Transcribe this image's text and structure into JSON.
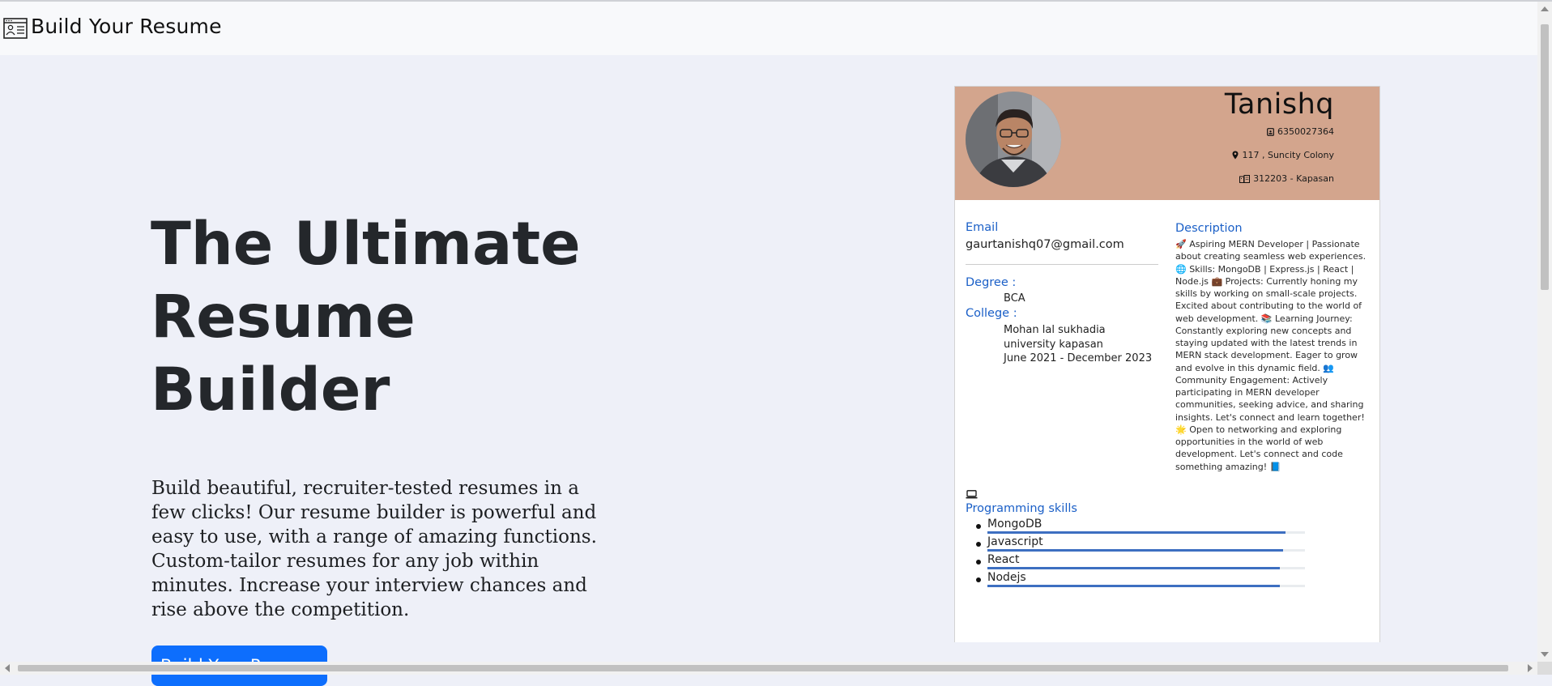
{
  "navbar": {
    "brand": "Build Your Resume",
    "brand_icon": "resume-card-icon"
  },
  "hero": {
    "title_lines": [
      "The Ultimate",
      "Resume",
      "Builder"
    ],
    "text": "Build beautiful, recruiter-tested resumes in a few clicks! Our resume builder is powerful and easy to use, with a range of amazing functions. Custom-tailor resumes for any job within minutes. Increase your interview chances and rise above the competition.",
    "button": "Build Your Resume"
  },
  "resume": {
    "header_color": "#d3a58d",
    "name": "Tanishq",
    "phone": "6350027364",
    "address": "117 , Suncity Colony",
    "pincode": "312203 - Kapasan",
    "email_label": "Email",
    "email": "gaurtanishq07@gmail.com",
    "degree_label": "Degree :",
    "degree": "BCA",
    "college_label": "College :",
    "college_name": "Mohan lal sukhadia university kapasan",
    "college_dates": "June 2021 - December 2023",
    "description_label": "Description",
    "description": "🚀 Aspiring MERN Developer | Passionate about creating seamless web experiences. 🌐 Skills: MongoDB | Express.js | React | Node.js 💼 Projects: Currently honing my skills by working on small-scale projects. Excited about contributing to the world of web development. 📚 Learning Journey: Constantly exploring new concepts and staying updated with the latest trends in MERN stack development. Eager to grow and evolve in this dynamic field. 👥 Community Engagement: Actively participating in MERN developer communities, seeking advice, and sharing insights. Let's connect and learn together! 🌟 Open to networking and exploring opportunities in the world of web development. Let's connect and code something amazing! 📘",
    "skills_label": "Programming skills",
    "skills_icon": "laptop-icon",
    "skills": [
      {
        "name": "MongoDB",
        "level": 0.94
      },
      {
        "name": "Javascript",
        "level": 0.93
      },
      {
        "name": "React",
        "level": 0.92
      },
      {
        "name": "Nodejs",
        "level": 0.92
      }
    ]
  },
  "colors": {
    "accent": "#0d6efd",
    "label_blue": "#1a5fc7",
    "bar": "#3d6fc1",
    "background": "#eef0f8"
  }
}
